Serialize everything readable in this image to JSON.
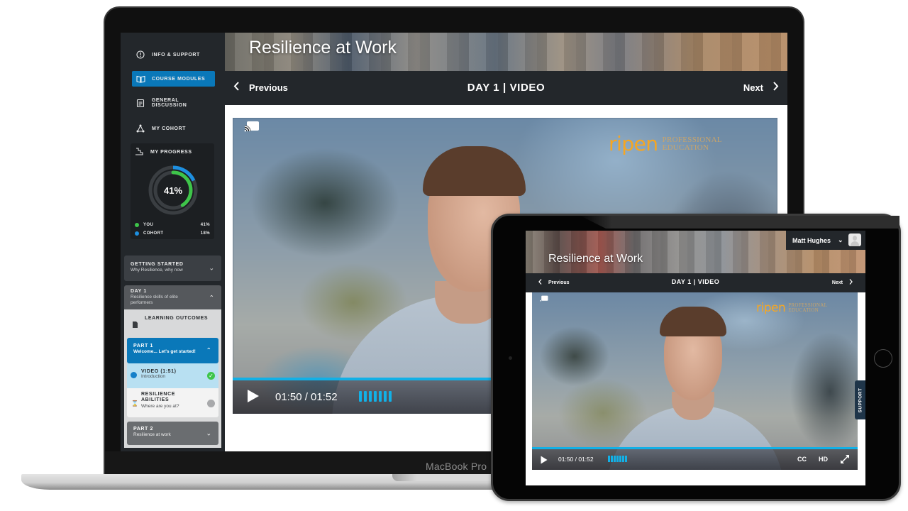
{
  "device_labels": {
    "laptop_brand": "MacBook Pro"
  },
  "colors": {
    "accent_blue": "#0a78b9",
    "video_cyan": "#12b0e6",
    "you_green": "#3ec54a",
    "cohort_blue": "#1d8fe0",
    "logo_orange": "#f5a623"
  },
  "sidebar": {
    "nav": [
      {
        "label": "INFO & SUPPORT",
        "icon": "info-icon",
        "active": false
      },
      {
        "label": "COURSE MODULES",
        "icon": "book-icon",
        "active": true
      },
      {
        "label": "GENERAL DISCUSSION",
        "icon": "clipboard-icon",
        "active": false
      },
      {
        "label": "MY COHORT",
        "icon": "network-icon",
        "active": false
      }
    ],
    "progress": {
      "title": "MY PROGRESS",
      "icon": "stairs-icon",
      "center_label": "41%",
      "you": {
        "label": "YOU",
        "value_text": "41%",
        "value": 41
      },
      "cohort": {
        "label": "COHORT",
        "value_text": "18%",
        "value": 18
      }
    },
    "modules": [
      {
        "title": "GETTING STARTED",
        "subtitle": "Why Resilience, why now",
        "expanded": false
      },
      {
        "title": "DAY 1",
        "subtitle": "Resilience skills of elite performers",
        "expanded": true
      }
    ],
    "day1_items": {
      "learning_outcomes": "LEARNING OUTCOMES",
      "part1": {
        "title": "PART 1",
        "subtitle": "Welcome... Let's get started!",
        "expanded": true
      },
      "lessons": [
        {
          "title": "VIDEO (1:51)",
          "subtitle": "Introduction",
          "status": "complete",
          "current": true
        },
        {
          "title": "RESILIENCE ABILITIES",
          "subtitle": "Where are you at?",
          "status": "incomplete",
          "current": false
        }
      ],
      "part2": {
        "title": "PART 2",
        "subtitle": "Resilience at work",
        "expanded": false
      }
    }
  },
  "course": {
    "title": "Resilience at Work",
    "prev_label": "Previous",
    "next_label": "Next",
    "section_label": "DAY 1 | VIDEO"
  },
  "video": {
    "logo_mark": "ripen",
    "logo_text_line1": "PROFESSIONAL",
    "logo_text_line2": "EDUCATION",
    "time_display": "01:50 / 01:52",
    "current_time": "01:50",
    "duration": "01:52",
    "progress_fraction": 0.98,
    "volume_bars": 7,
    "cc_label": "CC",
    "hd_label": "HD"
  },
  "tablet": {
    "user_name": "Matt Hughes",
    "support_label": "SUPPORT"
  }
}
